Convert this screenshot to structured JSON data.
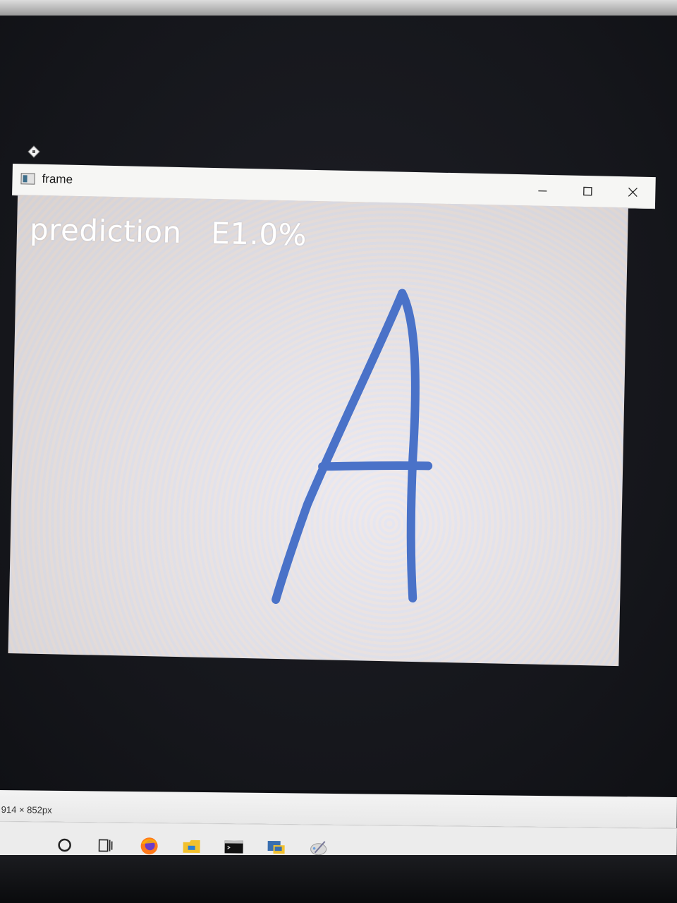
{
  "window": {
    "title": "frame",
    "minimize_icon": "minimize-icon",
    "maximize_icon": "maximize-icon",
    "close_icon": "close-icon"
  },
  "frame": {
    "prediction_label": "prediction",
    "prediction_value": "E1.0%",
    "drawn_letter": "A",
    "ink_color": "#4a72c8"
  },
  "status_bar": {
    "image_dimensions": "914 × 852px"
  },
  "taskbar": {
    "items": [
      {
        "name": "search-icon"
      },
      {
        "name": "task-view-icon"
      },
      {
        "name": "firefox-icon",
        "active": true
      },
      {
        "name": "file-explorer-icon",
        "active": true
      },
      {
        "name": "terminal-icon",
        "active": true
      },
      {
        "name": "python-icon",
        "active": true
      },
      {
        "name": "paint-icon",
        "active": true
      }
    ]
  }
}
